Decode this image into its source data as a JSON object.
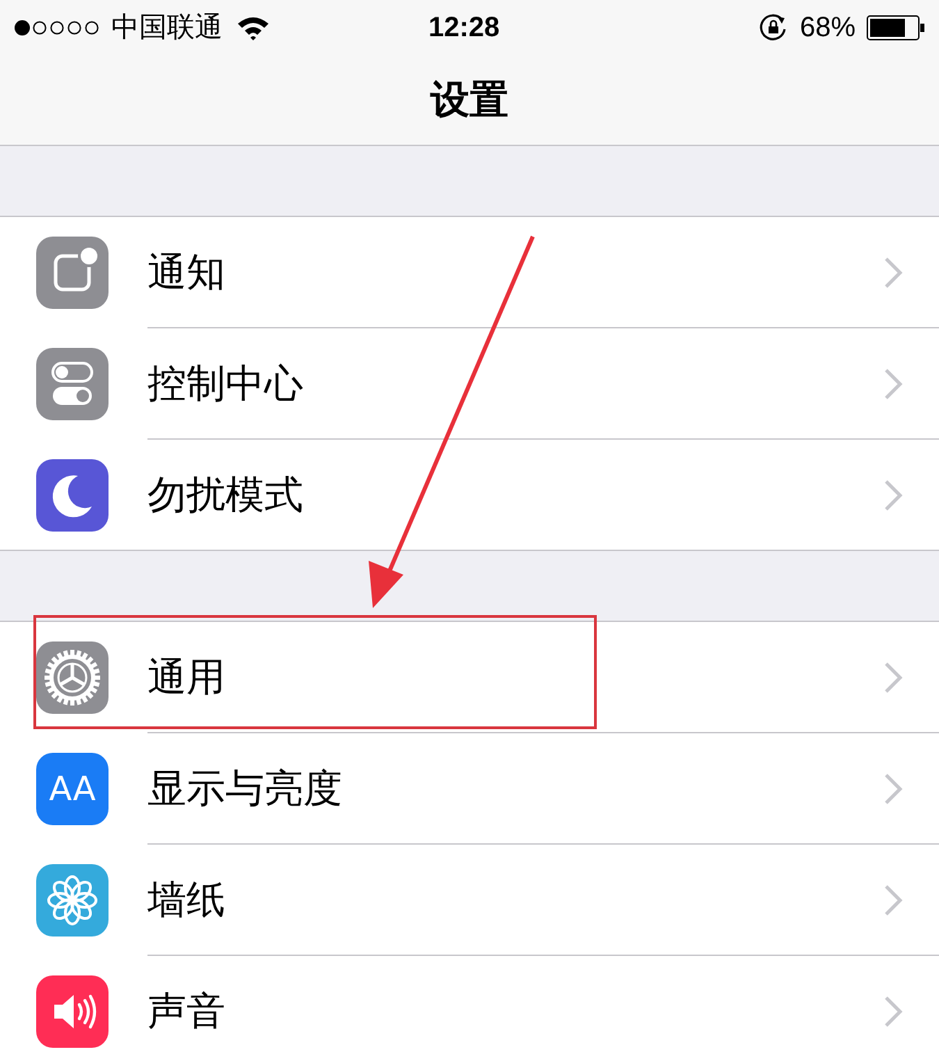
{
  "status_bar": {
    "carrier": "中国联通",
    "time": "12:28",
    "battery": "68%"
  },
  "nav_bar": {
    "title": "设置"
  },
  "groups": [
    {
      "items": [
        {
          "kind": "notifications",
          "label": "通知",
          "color": "#8e8e93",
          "highlighted": false
        },
        {
          "kind": "control",
          "label": "控制中心",
          "color": "#8e8e93",
          "highlighted": false
        },
        {
          "kind": "moon",
          "label": "勿扰模式",
          "color": "#5856d6",
          "highlighted": false
        }
      ]
    },
    {
      "items": [
        {
          "kind": "gear",
          "label": "通用",
          "color": "#8e8e93",
          "highlighted": true
        },
        {
          "kind": "text",
          "icon_text": "AA",
          "label": "显示与亮度",
          "color": "#1a7cf5",
          "highlighted": false
        },
        {
          "kind": "flower",
          "label": "墙纸",
          "color": "#34aadc",
          "highlighted": false
        },
        {
          "kind": "speaker",
          "label": "声音",
          "color": "#ff2d55",
          "highlighted": false
        }
      ]
    }
  ]
}
